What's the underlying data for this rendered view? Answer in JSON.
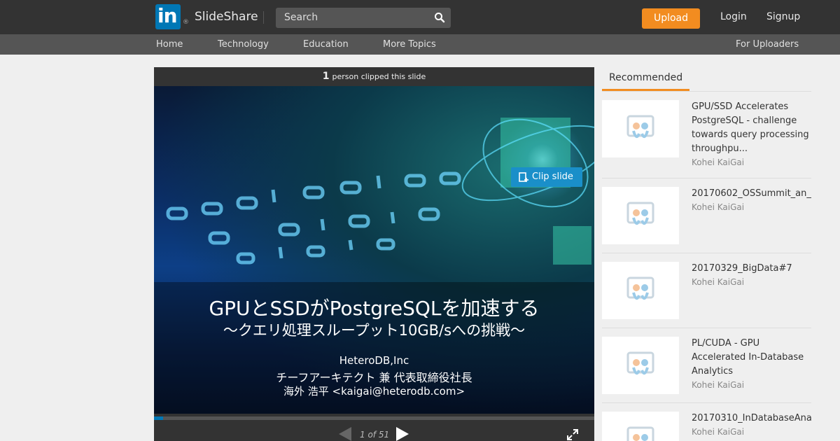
{
  "header": {
    "logo_text": "in",
    "logo_reg": "®",
    "brand": "SlideShare",
    "search_placeholder": "Search",
    "upload_label": "Upload",
    "login_label": "Login",
    "signup_label": "Signup"
  },
  "subnav": {
    "items": [
      "Home",
      "Technology",
      "Education",
      "More Topics"
    ],
    "right_item": "For Uploaders"
  },
  "player": {
    "clip_count": "1",
    "clip_text": "person clipped this slide",
    "clip_button_label": "Clip slide",
    "slide": {
      "title": "GPUとSSDがPostgreSQLを加速する",
      "subtitle": "～クエリ処理スループット10GB/sへの挑戦～",
      "company": "HeteroDB,Inc",
      "role": "チーフアーキテクト 兼 代表取締役社長",
      "author": "海外 浩平 <kaigai@heterodb.com>"
    },
    "page_label": "1 of 51",
    "progress": 0.02
  },
  "sidebar": {
    "tab_label": "Recommended",
    "items": [
      {
        "title": "GPU/SSD Accelerates\nPostgreSQL - challenge\ntowards query processing\nthroughpu...",
        "author": "Kohei KaiGai"
      },
      {
        "title": "20170602_OSSummit_an_",
        "author": "Kohei KaiGai"
      },
      {
        "title": "20170329_BigData#7",
        "author": "Kohei KaiGai"
      },
      {
        "title": "PL/CUDA - GPU\nAccelerated In-Database\nAnalytics",
        "author": "Kohei KaiGai"
      },
      {
        "title": "20170310_InDatabaseAna",
        "author": "Kohei KaiGai"
      }
    ]
  },
  "colors": {
    "accent": "#f28c20",
    "linkedin_blue": "#0077b5",
    "clip_blue": "#1a8fc9",
    "topbar": "#333333",
    "subnav": "#555555"
  }
}
